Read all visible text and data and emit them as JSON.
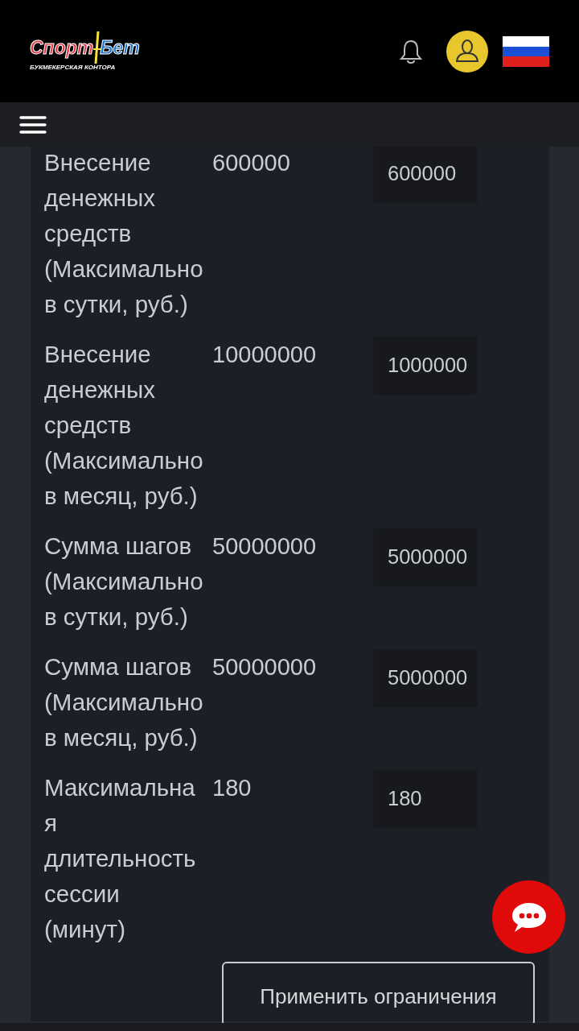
{
  "header": {
    "logo": {
      "word_1": "Спорт",
      "word_2": "Бет",
      "tagline": "БУКМЕКЕРСКАЯ КОНТОРА"
    }
  },
  "limits": [
    {
      "label": "Внесение денежных средств (Максимально в сутки, руб.)",
      "current": "600000",
      "value": "600000"
    },
    {
      "label": "Внесение денежных средств (Максимально в месяц, руб.)",
      "current": "10000000",
      "value": "1000000"
    },
    {
      "label": "Сумма шагов (Максимально в сутки, руб.)",
      "current": "50000000",
      "value": "5000000"
    },
    {
      "label": "Сумма шагов (Максимально в месяц, руб.)",
      "current": "50000000",
      "value": "5000000"
    },
    {
      "label": "Максимальная длительность сессии (минут)",
      "current": "180",
      "value": "180"
    }
  ],
  "apply_button": "Применить ограничения"
}
